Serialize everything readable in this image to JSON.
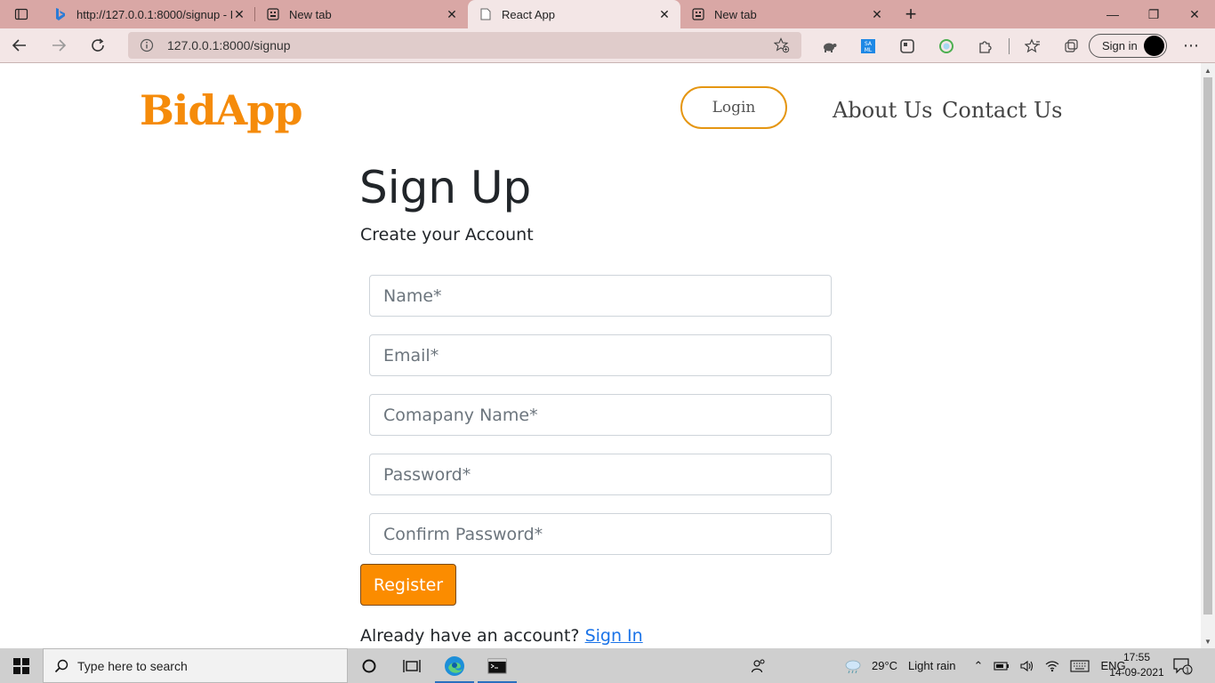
{
  "browser": {
    "tabs": [
      {
        "title": "http://127.0.0.1:8000/signup - Bi",
        "favicon": "bing-icon",
        "active": false
      },
      {
        "title": "New tab",
        "favicon": "newtab-icon",
        "active": false
      },
      {
        "title": "React App",
        "favicon": "page-icon",
        "active": true
      },
      {
        "title": "New tab",
        "favicon": "newtab-icon",
        "active": false
      }
    ],
    "url": "127.0.0.1:8000/signup",
    "signin_label": "Sign in"
  },
  "page": {
    "logo": "BidApp",
    "login_label": "Login",
    "nav": {
      "about": "About Us",
      "contact": "Contact Us"
    },
    "title": "Sign Up",
    "subtitle": "Create your Account",
    "fields": {
      "name": "Name*",
      "email": "Email*",
      "company": "Comapany Name*",
      "password": "Password*",
      "confirm": "Confirm Password*"
    },
    "register_label": "Register",
    "already_text": "Already have an account?",
    "signin_link": "Sign In"
  },
  "colors": {
    "brand": "#f58b0a",
    "register": "#fb8c00",
    "link": "#1a73e8",
    "tabstrip": "#d9a7a5"
  },
  "taskbar": {
    "search_placeholder": "Type here to search",
    "weather_temp": "29°C",
    "weather_desc": "Light rain",
    "lang": "ENG",
    "time": "17:55",
    "date": "14-09-2021",
    "notif_count": "1"
  }
}
